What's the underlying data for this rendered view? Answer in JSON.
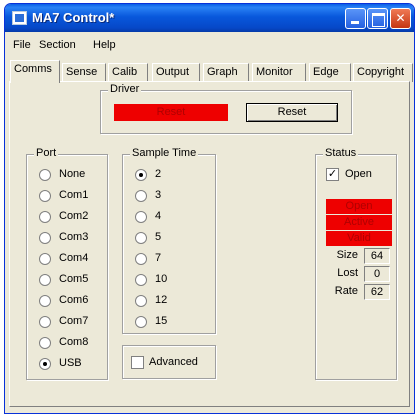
{
  "window": {
    "title": "MA7 Control*",
    "icons": {
      "app": "app-icon",
      "minimize": "minimize-icon",
      "maximize": "maximize-icon",
      "close": "close-icon"
    },
    "close_glyph": "✕",
    "colors": {
      "titlebar": "#0858dc",
      "close": "#c43512",
      "led": "#ee0000"
    }
  },
  "menu": [
    "File",
    "Section",
    "Help"
  ],
  "tabs": [
    "Comms",
    "Sense",
    "Calib",
    "Output",
    "Graph",
    "Monitor",
    "Edge",
    "Copyright"
  ],
  "active_tab": "Comms",
  "driver": {
    "label": "Driver",
    "indicator": "Reset",
    "reset_button": "Reset"
  },
  "port": {
    "label": "Port",
    "options": [
      "None",
      "Com1",
      "Com2",
      "Com3",
      "Com4",
      "Com5",
      "Com6",
      "Com7",
      "Com8",
      "USB"
    ],
    "selected": "USB"
  },
  "sample_time": {
    "label": "Sample Time",
    "options": [
      "2",
      "3",
      "4",
      "5",
      "7",
      "10",
      "12",
      "15"
    ],
    "selected": "2",
    "advanced_label": "Advanced",
    "advanced_checked": false
  },
  "status": {
    "label": "Status",
    "open_label": "Open",
    "open_checked": true,
    "indicators": [
      "Open",
      "Active",
      "Valid"
    ],
    "size_label": "Size",
    "size": "64",
    "lost_label": "Lost",
    "lost": "0",
    "rate_label": "Rate",
    "rate": "62"
  }
}
